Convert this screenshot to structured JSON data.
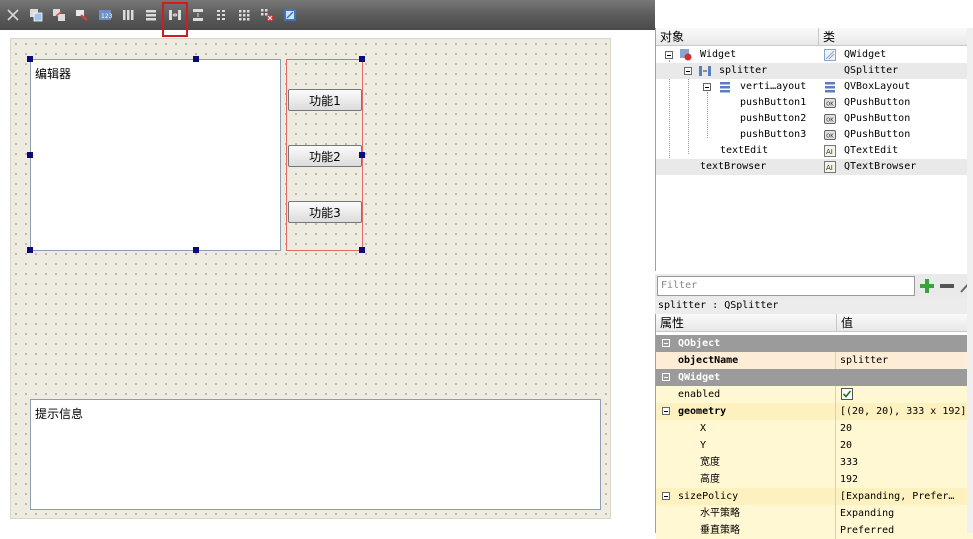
{
  "toolbar": {
    "buttons": [
      "close",
      "edit-widgets",
      "edit-signals-slots",
      "edit-buddies",
      "edit-tab-order",
      "layout-horizontal",
      "layout-vertical",
      "splitter-horizontal",
      "splitter-vertical",
      "layout-form",
      "layout-grid",
      "break-layout",
      "adjust-size"
    ],
    "highlighted": "splitter-horizontal"
  },
  "form": {
    "editor_text": "编辑器",
    "buttons": [
      "功能1",
      "功能2",
      "功能3"
    ],
    "browser_text": "提示信息"
  },
  "object_inspector": {
    "col_object": "对象",
    "col_class": "类",
    "rows": [
      {
        "name": "Widget",
        "cls": "QWidget",
        "icon": "widget-icon"
      },
      {
        "name": "splitter",
        "cls": "QSplitter",
        "icon": "splitter-icon"
      },
      {
        "name": "verti…ayout",
        "cls": "QVBoxLayout",
        "icon": "vboxlayout-icon"
      },
      {
        "name": "pushButton1",
        "cls": "QPushButton",
        "icon": "pushbutton-icon"
      },
      {
        "name": "pushButton2",
        "cls": "QPushButton",
        "icon": "pushbutton-icon"
      },
      {
        "name": "pushButton3",
        "cls": "QPushButton",
        "icon": "pushbutton-icon"
      },
      {
        "name": "textEdit",
        "cls": "QTextEdit",
        "icon": "textedit-icon"
      },
      {
        "name": "textBrowser",
        "cls": "QTextBrowser",
        "icon": "textbrowser-icon"
      }
    ]
  },
  "filter": {
    "placeholder": "Filter",
    "object_info": "splitter : QSplitter"
  },
  "property_editor": {
    "col_property": "属性",
    "col_value": "值",
    "rows": [
      {
        "name": "QObject",
        "value": "",
        "kind": "group"
      },
      {
        "name": "objectName",
        "value": "splitter",
        "kind": "bold"
      },
      {
        "name": "QWidget",
        "value": "",
        "kind": "group"
      },
      {
        "name": "enabled",
        "value": "",
        "kind": "check"
      },
      {
        "name": "geometry",
        "value": "[(20, 20), 333 x 192]",
        "kind": "bold"
      },
      {
        "name": "X",
        "value": "20",
        "kind": "child"
      },
      {
        "name": "Y",
        "value": "20",
        "kind": "child"
      },
      {
        "name": "宽度",
        "value": "333",
        "kind": "child"
      },
      {
        "name": "高度",
        "value": "192",
        "kind": "child"
      },
      {
        "name": "sizePolicy",
        "value": "[Expanding, Prefer…",
        "kind": "normal"
      },
      {
        "name": "水平策略",
        "value": "Expanding",
        "kind": "child"
      },
      {
        "name": "垂直策略",
        "value": "Preferred",
        "kind": "child"
      }
    ]
  },
  "colors": {
    "canvas": "#eeebe0",
    "handle": "#0a0a78",
    "layout_border": "#e26a6a",
    "group_row": "#9b9b9b",
    "highlight": "#d21c1c"
  }
}
